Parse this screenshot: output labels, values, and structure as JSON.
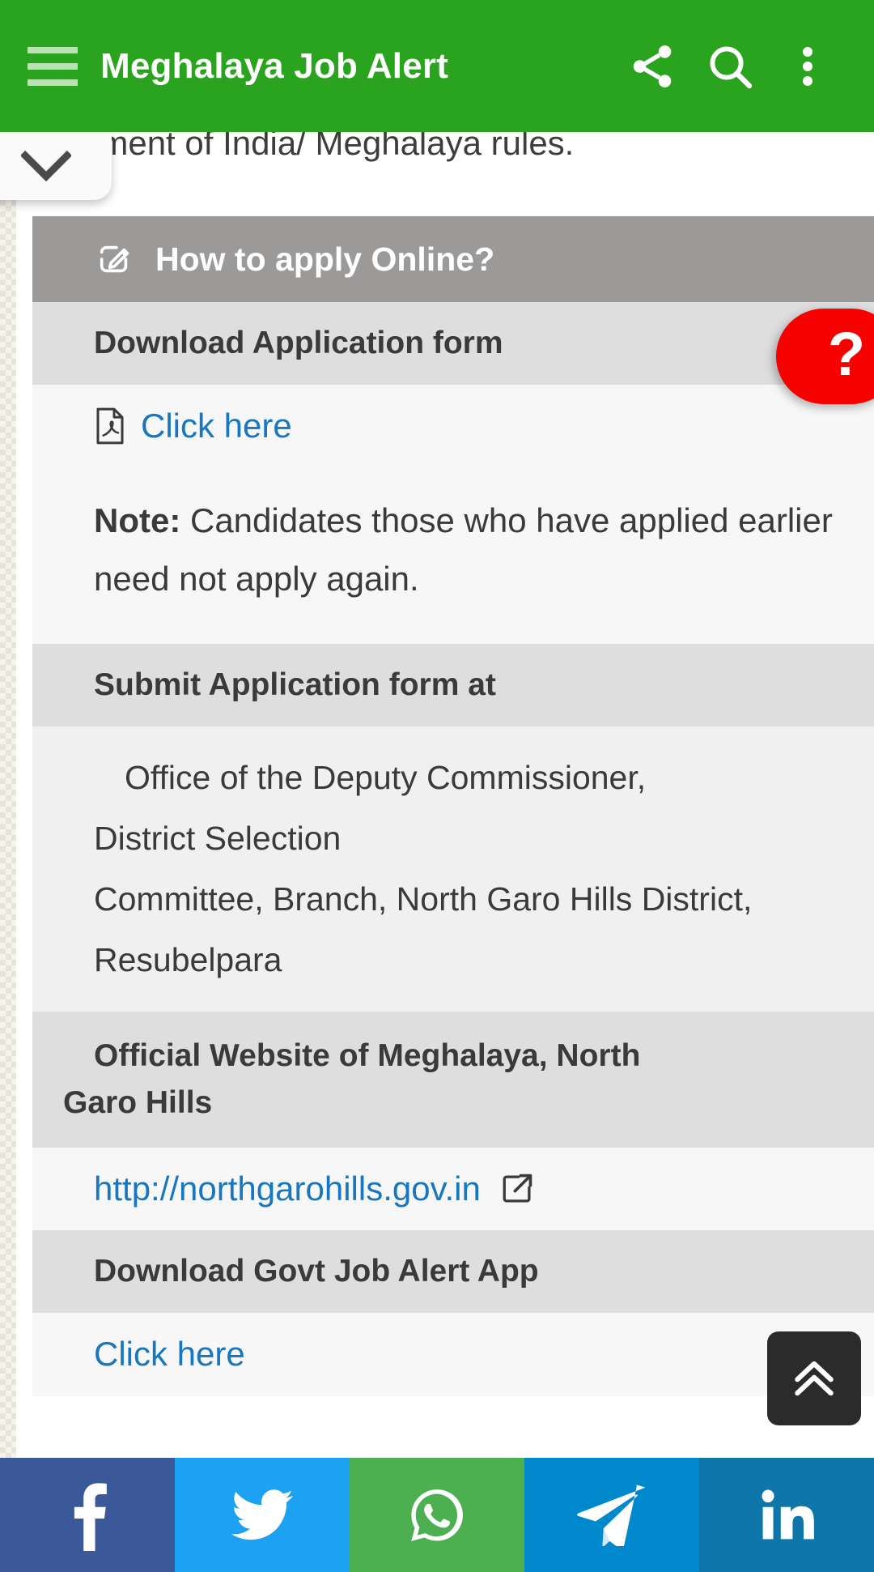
{
  "appbar": {
    "title": "Meghalaya Job Alert",
    "menu_icon": "hamburger-menu-icon",
    "share_icon": "share-icon",
    "search_icon": "search-icon",
    "overflow_icon": "more-vertical-icon",
    "background_color": "#2aa31e"
  },
  "article": {
    "clipped_top_line": "nment of India/ Meghalaya rules.",
    "collapse_toggle_icon": "chevron-down-icon"
  },
  "sections": {
    "how_to_apply": {
      "heading": "How to apply Online?",
      "icon": "edit-pencil-square-icon",
      "header_bg": "#9c9a99"
    },
    "download_form": {
      "label": "Download Application form",
      "link_text": "Click here",
      "link_icon": "pdf-file-icon",
      "link_color": "#1877bf"
    },
    "note": {
      "prefix": "Note:",
      "text": " Candidates those who have applied earlier need not apply again."
    },
    "submit_at": {
      "label": "Submit Application form at",
      "address_lines": [
        "Office of the Deputy Commissioner,",
        "District Selection",
        "Committee, Branch, North Garo Hills District,",
        "Resubelpara"
      ]
    },
    "official_website": {
      "label_line1": "Official Website of Meghalaya, North",
      "label_line2": "Garo Hills",
      "url": "http://northgarohills.gov.in",
      "url_icon": "external-link-icon"
    },
    "download_app": {
      "label": "Download Govt Job Alert App",
      "link_text": "Click here"
    }
  },
  "floating": {
    "help_badge": {
      "glyph": "?",
      "name": "help-badge",
      "color": "#f60000"
    },
    "scroll_top": {
      "icon": "double-chevron-up-icon",
      "color": "#2b2b2b"
    }
  },
  "social_bar": [
    {
      "name": "facebook",
      "icon": "facebook-icon",
      "color": "#3b5998"
    },
    {
      "name": "twitter",
      "icon": "twitter-bird-icon",
      "color": "#1da1f2"
    },
    {
      "name": "whatsapp",
      "icon": "whatsapp-icon",
      "color": "#4caf50"
    },
    {
      "name": "telegram",
      "icon": "telegram-paper-plane-icon",
      "color": "#0088cc"
    },
    {
      "name": "linkedin",
      "icon": "linkedin-icon",
      "color": "#0e76a8"
    }
  ]
}
